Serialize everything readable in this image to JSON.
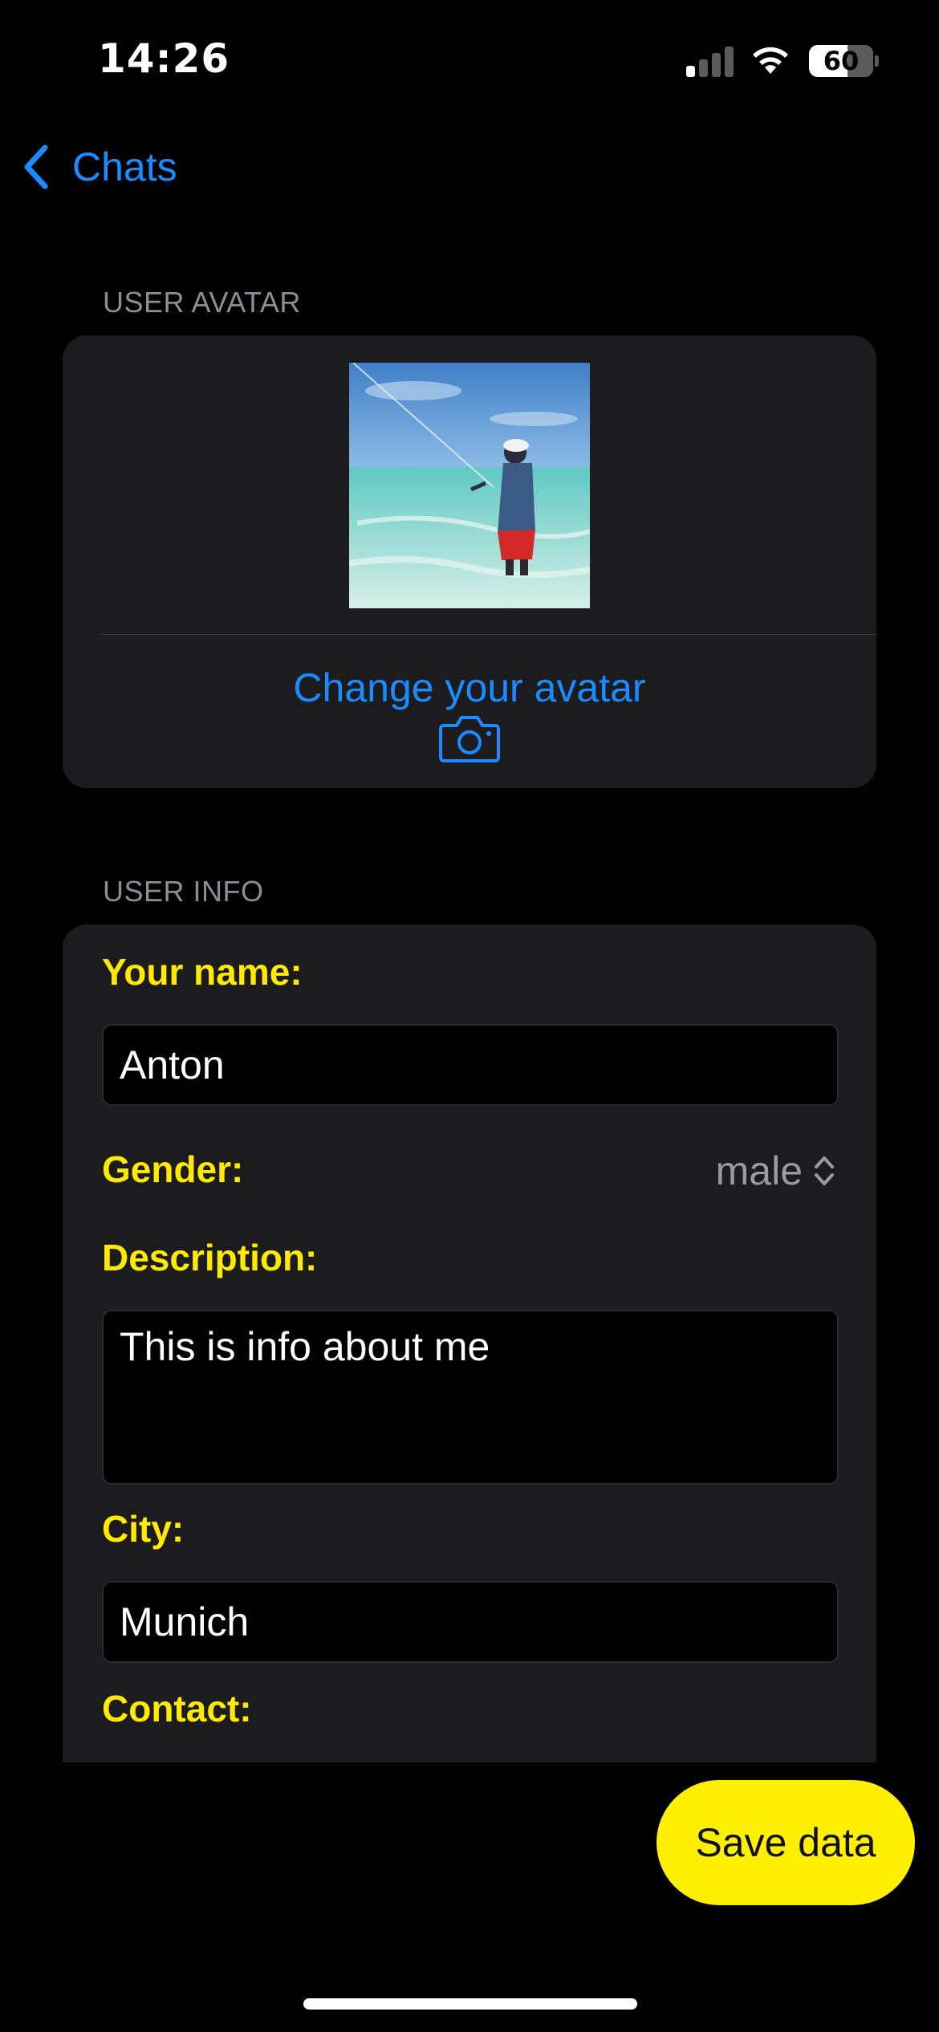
{
  "status_bar": {
    "time": "14:26",
    "battery_level": "60",
    "battery_fraction": 0.6,
    "signal_bars_active": 1,
    "signal_bars_total": 4
  },
  "nav": {
    "back_label": "Chats"
  },
  "avatar_section": {
    "header": "USER AVATAR",
    "change_label": "Change your avatar"
  },
  "info_section": {
    "header": "USER INFO",
    "name_label": "Your name:",
    "name_value": "Anton",
    "gender_label": "Gender:",
    "gender_value": "male",
    "description_label": "Description:",
    "description_value": "This is info about me",
    "city_label": "City:",
    "city_value": "Munich",
    "contact_label": "Contact:"
  },
  "save_button": {
    "label": "Save data"
  },
  "colors": {
    "accent_blue": "#1a8cff",
    "label_yellow": "#ffea00",
    "button_yellow": "#ffef00",
    "card_bg": "#1c1c1e"
  },
  "icons": [
    "chevron-left-icon",
    "camera-icon",
    "up-down-chevron-icon",
    "signal-icon",
    "wifi-icon",
    "battery-icon"
  ]
}
